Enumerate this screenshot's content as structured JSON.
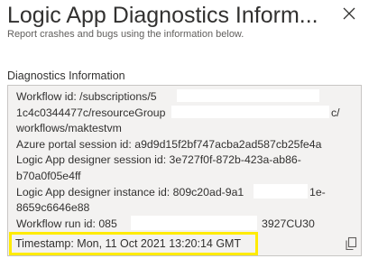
{
  "dialog": {
    "title": "Logic App Diagnostics Inform...",
    "subtitle": "Report crashes and bugs using the information below."
  },
  "diagnostics": {
    "label": "Diagnostics Information",
    "lines": [
      "Workflow id: /subscriptions/5",
      "1c4c0344477c/resourceGroup",
      "c/",
      "workflows/maktestvm",
      "Azure portal session id: a9d9d15f2bf747acba2ad587cb25fe4a",
      "Logic App designer session id: 3e727f0f-872b-423a-ab86-",
      "b70a0f05e4ff",
      "Logic App designer instance id: 809c20ad-9a1",
      "1e-",
      "8659c6646e88",
      "Workflow run id: 085",
      "3927CU30"
    ],
    "timestamp": "Timestamp: Mon, 11 Oct 2021 13:20:14 GMT"
  },
  "icons": {
    "close": "close-icon",
    "copy": "copy-icon"
  },
  "colors": {
    "highlight": "#ffeb00",
    "box_background": "#f3f2f1"
  }
}
